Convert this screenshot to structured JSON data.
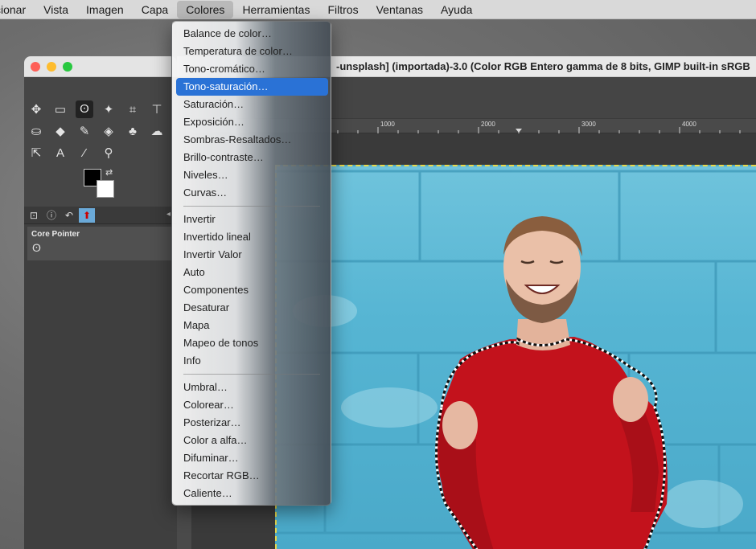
{
  "menubar": {
    "items": [
      "cionar",
      "Vista",
      "Imagen",
      "Capa",
      "Colores",
      "Herramientas",
      "Filtros",
      "Ventanas",
      "Ayuda"
    ],
    "active_index": 4
  },
  "image_window": {
    "title": "-unsplash] (importada)-3.0 (Color RGB Entero gamma de 8 bits, GIMP built-in sRGB",
    "ruler_ticks": [
      "1000",
      "2000",
      "3000",
      "4000"
    ]
  },
  "toolbox": {
    "pointer_panel_title": "Core Pointer"
  },
  "colors_menu": {
    "group1": [
      "Balance de color…",
      "Temperatura de color…",
      "Tono-cromático…",
      "Tono-saturación…",
      "Saturación…",
      "Exposición…",
      "Sombras-Resaltados…",
      "Brillo-contraste…",
      "Niveles…",
      "Curvas…"
    ],
    "group2": [
      "Invertir",
      "Invertido lineal",
      "Invertir Valor",
      "Auto",
      "Componentes",
      "Desaturar",
      "Mapa",
      "Mapeo de tonos",
      "Info"
    ],
    "group3": [
      "Umbral…",
      "Colorear…",
      "Posterizar…",
      "Color a alfa…",
      "Difuminar…",
      "Recortar RGB…",
      "Caliente…"
    ],
    "highlighted": "Tono-saturación…"
  },
  "theme": {
    "highlight": "#2a72d6",
    "selection_marching_ants": "#e8d94c",
    "sweater_red": "#c3121c",
    "wall_blue": "#56b5d3"
  }
}
